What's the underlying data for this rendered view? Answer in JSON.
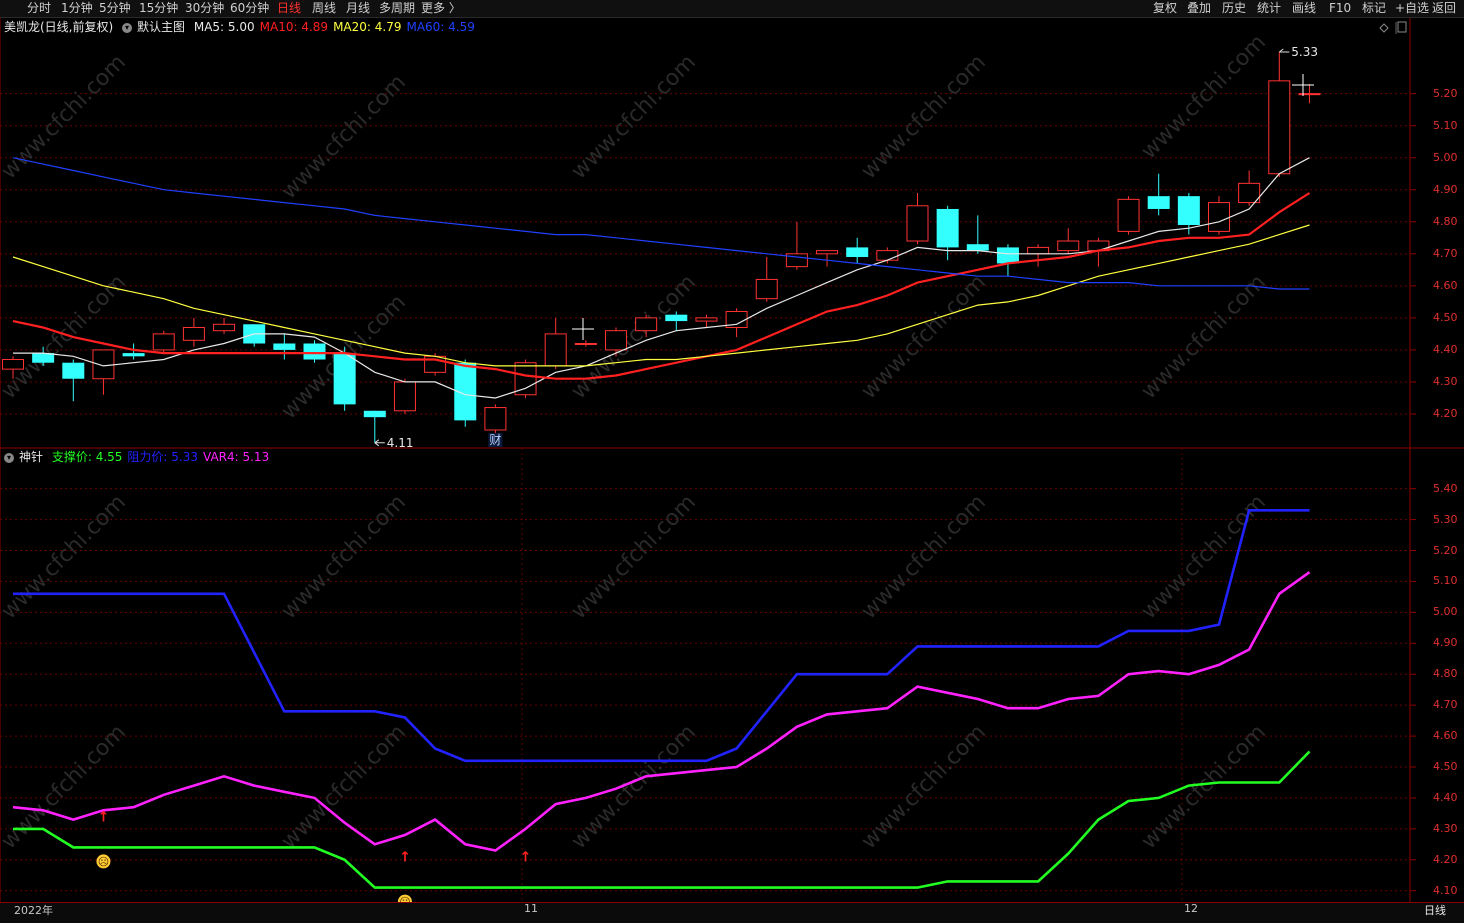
{
  "toolbar": {
    "left": [
      "分时",
      "1分钟",
      "5分钟",
      "15分钟",
      "30分钟",
      "60分钟",
      "日线",
      "周线",
      "月线",
      "多周期",
      "更多 〉"
    ],
    "active": "日线",
    "right": [
      "复权",
      "叠加",
      "历史",
      "统计",
      "画线",
      "F10",
      "标记",
      "+自选",
      "返回"
    ]
  },
  "main_panel": {
    "stock": "美凯龙(日线,前复权)",
    "template": "默认主图",
    "ma": [
      {
        "label": "MA5: 5.00",
        "color": "#e8e8e8"
      },
      {
        "label": "MA10: 4.89",
        "color": "#ff2020"
      },
      {
        "label": "MA20: 4.79",
        "color": "#ffff40"
      },
      {
        "label": "MA60: 4.59",
        "color": "#2040ff"
      }
    ],
    "high_label": "5.33",
    "low_label": "4.11",
    "event_label": "财",
    "yticks": [
      "5.20",
      "5.10",
      "5.00",
      "4.90",
      "4.80",
      "4.70",
      "4.60",
      "4.50",
      "4.40",
      "4.30",
      "4.20"
    ]
  },
  "sub_panel": {
    "name": "神针",
    "legend": [
      {
        "label": "支撑价: 4.55",
        "color": "#22ff22"
      },
      {
        "label": "阻力价: 5.33",
        "color": "#2222ff"
      },
      {
        "label": "VAR4: 5.13",
        "color": "#ff22ff"
      }
    ],
    "yticks": [
      "5.40",
      "5.30",
      "5.20",
      "5.10",
      "5.00",
      "4.90",
      "4.80",
      "4.70",
      "4.60",
      "4.50",
      "4.40",
      "4.30",
      "4.20",
      "4.10"
    ],
    "arrow_symbol": "↑",
    "face_symbol": "☹"
  },
  "dates": {
    "d1": "2022年",
    "d2": "11",
    "d3": "12"
  },
  "status_right": "日线",
  "watermark": "www.cfchi.com",
  "chart_data": [
    {
      "type": "candlestick",
      "title": "美凯龙(日线,前复权)",
      "ylim": [
        4.1,
        5.38
      ],
      "candles": [
        {
          "o": 4.34,
          "c": 4.37,
          "h": 4.38,
          "l": 4.31
        },
        {
          "o": 4.39,
          "c": 4.36,
          "h": 4.41,
          "l": 4.35
        },
        {
          "o": 4.36,
          "c": 4.31,
          "h": 4.37,
          "l": 4.24
        },
        {
          "o": 4.31,
          "c": 4.4,
          "h": 4.4,
          "l": 4.26
        },
        {
          "o": 4.39,
          "c": 4.38,
          "h": 4.42,
          "l": 4.37
        },
        {
          "o": 4.4,
          "c": 4.45,
          "h": 4.46,
          "l": 4.39
        },
        {
          "o": 4.43,
          "c": 4.47,
          "h": 4.5,
          "l": 4.41
        },
        {
          "o": 4.46,
          "c": 4.48,
          "h": 4.5,
          "l": 4.45
        },
        {
          "o": 4.48,
          "c": 4.42,
          "h": 4.48,
          "l": 4.41
        },
        {
          "o": 4.42,
          "c": 4.4,
          "h": 4.45,
          "l": 4.37
        },
        {
          "o": 4.42,
          "c": 4.37,
          "h": 4.43,
          "l": 4.36
        },
        {
          "o": 4.39,
          "c": 4.23,
          "h": 4.41,
          "l": 4.21
        },
        {
          "o": 4.21,
          "c": 4.19,
          "h": 4.21,
          "l": 4.11
        },
        {
          "o": 4.21,
          "c": 4.3,
          "h": 4.31,
          "l": 4.2
        },
        {
          "o": 4.33,
          "c": 4.38,
          "h": 4.39,
          "l": 4.32
        },
        {
          "o": 4.36,
          "c": 4.18,
          "h": 4.37,
          "l": 4.16
        },
        {
          "o": 4.15,
          "c": 4.22,
          "h": 4.23,
          "l": 4.14
        },
        {
          "o": 4.26,
          "c": 4.36,
          "h": 4.37,
          "l": 4.25
        },
        {
          "o": 4.35,
          "c": 4.45,
          "h": 4.5,
          "l": 4.34
        },
        {
          "o": 4.42,
          "c": 4.42,
          "h": 4.43,
          "l": 4.41
        },
        {
          "o": 4.4,
          "c": 4.46,
          "h": 4.47,
          "l": 4.38
        },
        {
          "o": 4.46,
          "c": 4.5,
          "h": 4.51,
          "l": 4.44
        },
        {
          "o": 4.51,
          "c": 4.49,
          "h": 4.52,
          "l": 4.46
        },
        {
          "o": 4.49,
          "c": 4.5,
          "h": 4.51,
          "l": 4.47
        },
        {
          "o": 4.47,
          "c": 4.52,
          "h": 4.53,
          "l": 4.44
        },
        {
          "o": 4.56,
          "c": 4.62,
          "h": 4.69,
          "l": 4.55
        },
        {
          "o": 4.66,
          "c": 4.7,
          "h": 4.8,
          "l": 4.65
        },
        {
          "o": 4.7,
          "c": 4.71,
          "h": 4.71,
          "l": 4.66
        },
        {
          "o": 4.72,
          "c": 4.69,
          "h": 4.75,
          "l": 4.67
        },
        {
          "o": 4.68,
          "c": 4.71,
          "h": 4.72,
          "l": 4.67
        },
        {
          "o": 4.74,
          "c": 4.85,
          "h": 4.89,
          "l": 4.73
        },
        {
          "o": 4.84,
          "c": 4.72,
          "h": 4.85,
          "l": 4.68
        },
        {
          "o": 4.73,
          "c": 4.71,
          "h": 4.82,
          "l": 4.7
        },
        {
          "o": 4.72,
          "c": 4.67,
          "h": 4.73,
          "l": 4.63
        },
        {
          "o": 4.7,
          "c": 4.72,
          "h": 4.73,
          "l": 4.66
        },
        {
          "o": 4.71,
          "c": 4.74,
          "h": 4.78,
          "l": 4.7
        },
        {
          "o": 4.71,
          "c": 4.74,
          "h": 4.75,
          "l": 4.66
        },
        {
          "o": 4.77,
          "c": 4.87,
          "h": 4.88,
          "l": 4.76
        },
        {
          "o": 4.88,
          "c": 4.84,
          "h": 4.95,
          "l": 4.82
        },
        {
          "o": 4.88,
          "c": 4.79,
          "h": 4.89,
          "l": 4.76
        },
        {
          "o": 4.77,
          "c": 4.86,
          "h": 4.88,
          "l": 4.76
        },
        {
          "o": 4.86,
          "c": 4.92,
          "h": 4.96,
          "l": 4.85
        },
        {
          "o": 4.95,
          "c": 5.24,
          "h": 5.33,
          "l": 4.94
        },
        {
          "o": 5.2,
          "c": 5.2,
          "h": 5.23,
          "l": 5.17
        }
      ],
      "series": [
        {
          "name": "MA5",
          "values": [
            4.39,
            4.39,
            4.38,
            4.35,
            4.36,
            4.37,
            4.4,
            4.42,
            4.45,
            4.45,
            4.44,
            4.39,
            4.33,
            4.3,
            4.3,
            4.26,
            4.25,
            4.28,
            4.33,
            4.35,
            4.39,
            4.43,
            4.46,
            4.47,
            4.48,
            4.53,
            4.57,
            4.61,
            4.65,
            4.68,
            4.72,
            4.71,
            4.71,
            4.7,
            4.7,
            4.7,
            4.71,
            4.74,
            4.77,
            4.78,
            4.8,
            4.84,
            4.95,
            5.0
          ]
        },
        {
          "name": "MA10",
          "values": [
            4.49,
            4.47,
            4.44,
            4.42,
            4.4,
            4.39,
            4.39,
            4.39,
            4.39,
            4.39,
            4.39,
            4.39,
            4.38,
            4.37,
            4.37,
            4.35,
            4.34,
            4.32,
            4.31,
            4.31,
            4.32,
            4.34,
            4.36,
            4.38,
            4.4,
            4.44,
            4.48,
            4.52,
            4.54,
            4.57,
            4.61,
            4.63,
            4.65,
            4.67,
            4.68,
            4.69,
            4.71,
            4.72,
            4.74,
            4.75,
            4.75,
            4.76,
            4.83,
            4.89
          ]
        },
        {
          "name": "MA20",
          "values": [
            4.69,
            4.66,
            4.63,
            4.6,
            4.58,
            4.56,
            4.53,
            4.51,
            4.49,
            4.47,
            4.45,
            4.43,
            4.41,
            4.39,
            4.38,
            4.36,
            4.35,
            4.35,
            4.35,
            4.35,
            4.36,
            4.37,
            4.37,
            4.38,
            4.39,
            4.4,
            4.41,
            4.42,
            4.43,
            4.45,
            4.48,
            4.51,
            4.54,
            4.55,
            4.57,
            4.6,
            4.63,
            4.65,
            4.67,
            4.69,
            4.71,
            4.73,
            4.76,
            4.79
          ]
        },
        {
          "name": "MA60",
          "values": [
            5.0,
            4.98,
            4.96,
            4.94,
            4.92,
            4.9,
            4.89,
            4.88,
            4.87,
            4.86,
            4.85,
            4.84,
            4.82,
            4.81,
            4.8,
            4.79,
            4.78,
            4.77,
            4.76,
            4.76,
            4.75,
            4.74,
            4.73,
            4.72,
            4.71,
            4.7,
            4.69,
            4.68,
            4.67,
            4.66,
            4.65,
            4.64,
            4.63,
            4.63,
            4.62,
            4.61,
            4.61,
            4.61,
            4.6,
            4.6,
            4.6,
            4.6,
            4.59,
            4.59
          ]
        }
      ]
    },
    {
      "type": "line",
      "title": "神针",
      "ylim": [
        4.07,
        5.47
      ],
      "series": [
        {
          "name": "支撑价",
          "values": [
            4.3,
            4.3,
            4.24,
            4.24,
            4.24,
            4.24,
            4.24,
            4.24,
            4.24,
            4.24,
            4.24,
            4.2,
            4.11,
            4.11,
            4.11,
            4.11,
            4.11,
            4.11,
            4.11,
            4.11,
            4.11,
            4.11,
            4.11,
            4.11,
            4.11,
            4.11,
            4.11,
            4.11,
            4.11,
            4.11,
            4.11,
            4.13,
            4.13,
            4.13,
            4.13,
            4.22,
            4.33,
            4.39,
            4.4,
            4.44,
            4.45,
            4.45,
            4.45,
            4.55
          ]
        },
        {
          "name": "阻力价",
          "values": [
            5.06,
            5.06,
            5.06,
            5.06,
            5.06,
            5.06,
            5.06,
            5.06,
            4.87,
            4.68,
            4.68,
            4.68,
            4.68,
            4.66,
            4.56,
            4.52,
            4.52,
            4.52,
            4.52,
            4.52,
            4.52,
            4.52,
            4.52,
            4.52,
            4.56,
            4.68,
            4.8,
            4.8,
            4.8,
            4.8,
            4.89,
            4.89,
            4.89,
            4.89,
            4.89,
            4.89,
            4.89,
            4.94,
            4.94,
            4.94,
            4.96,
            5.33,
            5.33,
            5.33
          ]
        },
        {
          "name": "VAR4",
          "values": [
            4.37,
            4.36,
            4.33,
            4.36,
            4.37,
            4.41,
            4.44,
            4.47,
            4.44,
            4.42,
            4.4,
            4.32,
            4.25,
            4.28,
            4.33,
            4.25,
            4.23,
            4.3,
            4.38,
            4.4,
            4.43,
            4.47,
            4.48,
            4.49,
            4.5,
            4.56,
            4.63,
            4.67,
            4.68,
            4.69,
            4.76,
            4.74,
            4.72,
            4.69,
            4.69,
            4.72,
            4.73,
            4.8,
            4.81,
            4.8,
            4.83,
            4.88,
            5.06,
            5.13
          ]
        }
      ],
      "markers": [
        {
          "kind": "arrow",
          "index": 3
        },
        {
          "kind": "face",
          "index": 3
        },
        {
          "kind": "arrow",
          "index": 13
        },
        {
          "kind": "face",
          "index": 13
        },
        {
          "kind": "arrow",
          "index": 17
        }
      ]
    }
  ]
}
